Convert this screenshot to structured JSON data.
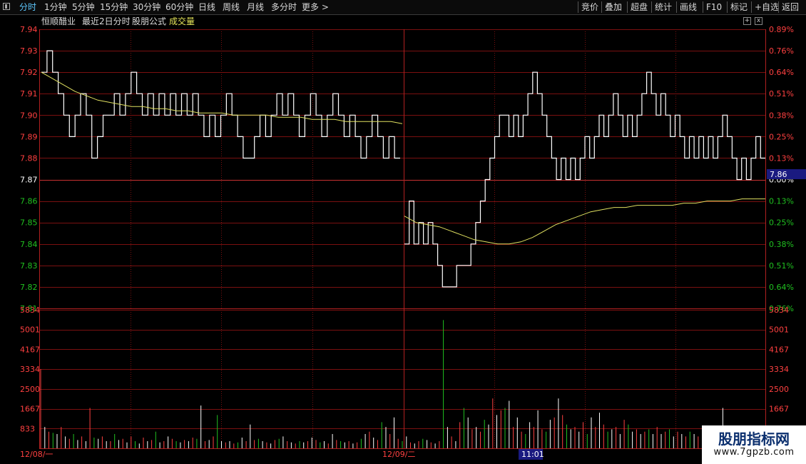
{
  "toolbar": {
    "left": [
      "分时",
      "1分钟",
      "5分钟",
      "15分钟",
      "30分钟",
      "60分钟",
      "日线",
      "周线",
      "月线",
      "多分时",
      "更多 >"
    ],
    "active_index": 0,
    "right": [
      "竞价",
      "叠加",
      "超盘",
      "统计",
      "画线",
      "F10",
      "标记",
      "+自选",
      "返回"
    ]
  },
  "info": {
    "stock": "恒顺醋业",
    "mode": "最近2日分时",
    "formula": "股朋公式",
    "volume_label": "成交量"
  },
  "controls": {
    "add": "+",
    "close": "x"
  },
  "axes": {
    "price_ticks": [
      "7.94",
      "7.93",
      "7.92",
      "7.91",
      "7.90",
      "7.89",
      "7.88",
      "7.87",
      "7.86",
      "7.85",
      "7.84",
      "7.83",
      "7.82",
      "7.81"
    ],
    "pct_ticks": [
      "0.89%",
      "0.76%",
      "0.64%",
      "0.51%",
      "0.38%",
      "0.25%",
      "0.13%",
      "0.00%",
      "0.13%",
      "0.25%",
      "0.38%",
      "0.51%",
      "0.64%",
      "0.76%"
    ],
    "volume_ticks": [
      "5834",
      "5001",
      "4167",
      "3334",
      "2500",
      "1667",
      "833"
    ],
    "date_labels": [
      "12/08/一",
      "12/09/二"
    ],
    "cursor_time": "11:01",
    "cursor_price": "7.86",
    "volume_cut_label": "833"
  },
  "colors": {
    "grid": "#7a1010",
    "price_line": "#ffffff",
    "avg_line": "#e0e060",
    "vol_up": "#ff4040",
    "vol_down": "#20c020",
    "vol_flat": "#ffffff",
    "axis_up": "#ff4040",
    "axis_flat": "#ffffff",
    "axis_down": "#20c020",
    "accent": "#5ec8ff"
  },
  "chart_data": {
    "type": "line",
    "prev_close": 7.87,
    "price_range": [
      7.81,
      7.94
    ],
    "volume_range": [
      0,
      5834
    ],
    "series": [
      {
        "name": "price",
        "values": [
          7.92,
          7.93,
          7.92,
          7.91,
          7.9,
          7.89,
          7.9,
          7.91,
          7.9,
          7.88,
          7.89,
          7.9,
          7.9,
          7.91,
          7.9,
          7.91,
          7.92,
          7.91,
          7.9,
          7.91,
          7.9,
          7.91,
          7.9,
          7.91,
          7.9,
          7.91,
          7.9,
          7.91,
          7.9,
          7.89,
          7.9,
          7.89,
          7.9,
          7.91,
          7.9,
          7.89,
          7.88,
          7.88,
          7.89,
          7.9,
          7.89,
          7.9,
          7.91,
          7.9,
          7.91,
          7.9,
          7.89,
          7.9,
          7.91,
          7.9,
          7.89,
          7.9,
          7.91,
          7.9,
          7.89,
          7.9,
          7.89,
          7.88,
          7.89,
          7.9,
          7.89,
          7.88,
          7.89,
          7.88,
          7.88,
          7.84,
          7.86,
          7.84,
          7.85,
          7.84,
          7.85,
          7.84,
          7.83,
          7.82,
          7.82,
          7.82,
          7.83,
          7.83,
          7.83,
          7.84,
          7.85,
          7.86,
          7.87,
          7.88,
          7.89,
          7.9,
          7.9,
          7.89,
          7.9,
          7.89,
          7.9,
          7.91,
          7.92,
          7.91,
          7.9,
          7.89,
          7.88,
          7.87,
          7.88,
          7.87,
          7.88,
          7.87,
          7.88,
          7.89,
          7.88,
          7.89,
          7.9,
          7.89,
          7.9,
          7.91,
          7.9,
          7.89,
          7.9,
          7.89,
          7.9,
          7.91,
          7.92,
          7.91,
          7.9,
          7.91,
          7.9,
          7.89,
          7.9,
          7.89,
          7.88,
          7.89,
          7.88,
          7.89,
          7.88,
          7.89,
          7.88,
          7.89,
          7.9,
          7.89,
          7.88,
          7.87,
          7.88,
          7.87,
          7.88,
          7.89,
          7.88,
          7.88
        ]
      },
      {
        "name": "average",
        "values": [
          7.92,
          7.917,
          7.914,
          7.911,
          7.909,
          7.907,
          7.906,
          7.905,
          7.904,
          7.904,
          7.903,
          7.903,
          7.902,
          7.902,
          7.901,
          7.901,
          7.901,
          7.9,
          7.9,
          7.9,
          7.9,
          7.899,
          7.899,
          7.899,
          7.898,
          7.898,
          7.898,
          7.897,
          7.897,
          7.897,
          7.897,
          7.897,
          7.896,
          7.853,
          7.85,
          7.849,
          7.848,
          7.846,
          7.844,
          7.842,
          7.841,
          7.84,
          7.84,
          7.841,
          7.843,
          7.846,
          7.849,
          7.851,
          7.853,
          7.855,
          7.856,
          7.857,
          7.857,
          7.858,
          7.858,
          7.858,
          7.858,
          7.859,
          7.859,
          7.86,
          7.86,
          7.86,
          7.861,
          7.861,
          7.861
        ]
      }
    ],
    "volume": [
      3334,
      900,
      700,
      650,
      600,
      900,
      500,
      400,
      600,
      350,
      500,
      300,
      1700,
      450,
      400,
      500,
      300,
      300,
      600,
      350,
      400,
      250,
      500,
      300,
      200,
      450,
      300,
      350,
      700,
      250,
      300,
      500,
      400,
      300,
      250,
      350,
      300,
      450,
      400,
      1800,
      300,
      350,
      500,
      1400,
      300,
      250,
      300,
      200,
      250,
      450,
      300,
      1000,
      350,
      400,
      300,
      250,
      200,
      350,
      400,
      500,
      300,
      250,
      200,
      300,
      250,
      300,
      450,
      350,
      250,
      300,
      200,
      600,
      350,
      300,
      250,
      300,
      200,
      250,
      400,
      600,
      700,
      450,
      350,
      1100,
      900,
      600,
      1300,
      400,
      300,
      500,
      250,
      200,
      300,
      400,
      350,
      250,
      200,
      300,
      5400,
      900,
      500,
      300,
      1100,
      1700,
      1300,
      800,
      900,
      700,
      1200,
      1000,
      2100,
      1400,
      1600,
      1700,
      2000,
      900,
      1300,
      700,
      600,
      1100,
      900,
      1600,
      800,
      700,
      1200,
      1300,
      2100,
      1400,
      1000,
      800,
      900,
      700,
      1100,
      600,
      1300,
      900,
      1500,
      1000,
      700,
      800,
      900,
      600,
      1200,
      1000,
      700,
      800,
      600,
      700,
      800,
      600,
      900,
      600,
      700,
      800,
      500,
      700,
      600,
      500,
      700,
      600,
      500,
      800,
      600,
      500,
      700,
      400,
      1700,
      500,
      600,
      400,
      500,
      300,
      700,
      400,
      500,
      600,
      400
    ]
  }
}
